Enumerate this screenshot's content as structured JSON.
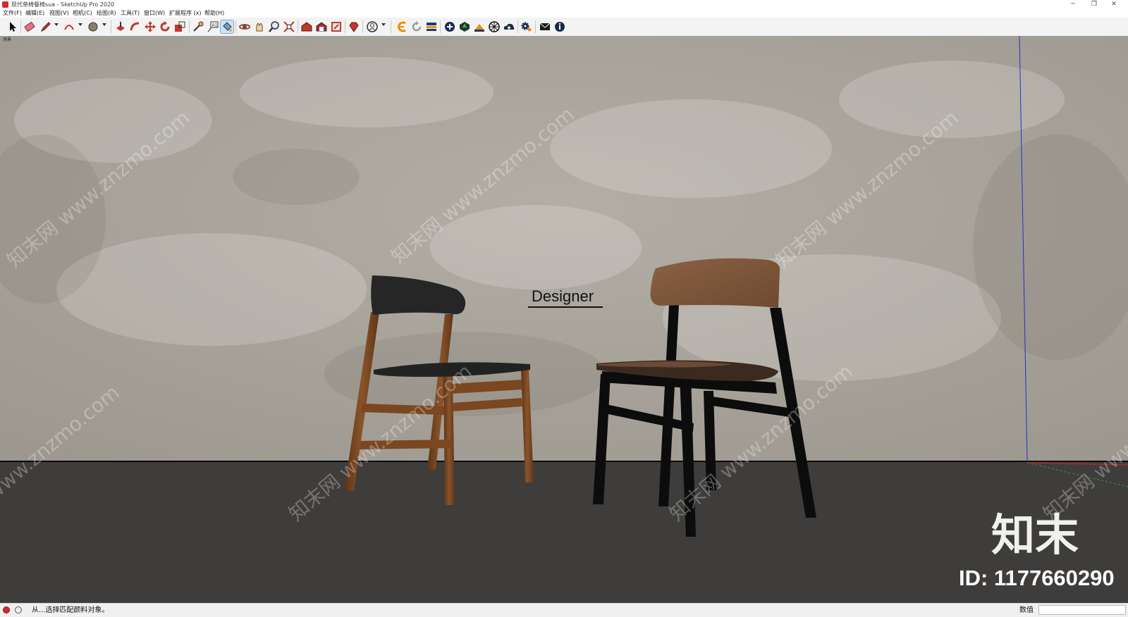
{
  "window": {
    "title": "现代单椅餐椅sua - SketchUp Pro 2020",
    "controls": {
      "minimize": "─",
      "restore": "❐",
      "close": "✕"
    }
  },
  "menu": [
    "文件(F)",
    "编辑(E)",
    "视图(V)",
    "相机(C)",
    "绘图(R)",
    "工具(T)",
    "窗口(W)",
    "扩展程序 (x)",
    "帮助(H)"
  ],
  "toolbar": {
    "tools": [
      "select-icon",
      "eraser-icon",
      "pencil-icon",
      "arc-icon",
      "circle-icon",
      "push-pull-icon",
      "follow-me-icon",
      "move-icon",
      "rotate-icon",
      "scale-icon",
      "tape-measure-icon",
      "text-icon",
      "paint-bucket-icon",
      "orbit-icon",
      "pan-icon",
      "zoom-icon",
      "zoom-extents-icon",
      "warehouse-icon",
      "extension-warehouse-icon",
      "layout-icon",
      "ruby-icon",
      "account-icon",
      "plugin-orange-icon",
      "refresh-icon",
      "plugin-bar-icon",
      "plus-circle-icon",
      "gem-icon",
      "sandbox-icon",
      "globe-icon",
      "cloud-icon",
      "gears-icon",
      "mail-icon",
      "info-icon"
    ]
  },
  "viewport": {
    "scene_tab": "场景",
    "designer_label": "Designer",
    "watermark_text": "知末网 www.znzmo.com",
    "brand_logo": "知末",
    "image_id": "ID: 1177660290",
    "colors": {
      "wall": "#a9a49b",
      "floor": "#3f3d3b",
      "axis_blue": "#2a2ad8",
      "axis_red": "#d0262c"
    }
  },
  "status": {
    "message": "从...选择匹配颜料对象。",
    "value_label": "数值",
    "value": ""
  }
}
